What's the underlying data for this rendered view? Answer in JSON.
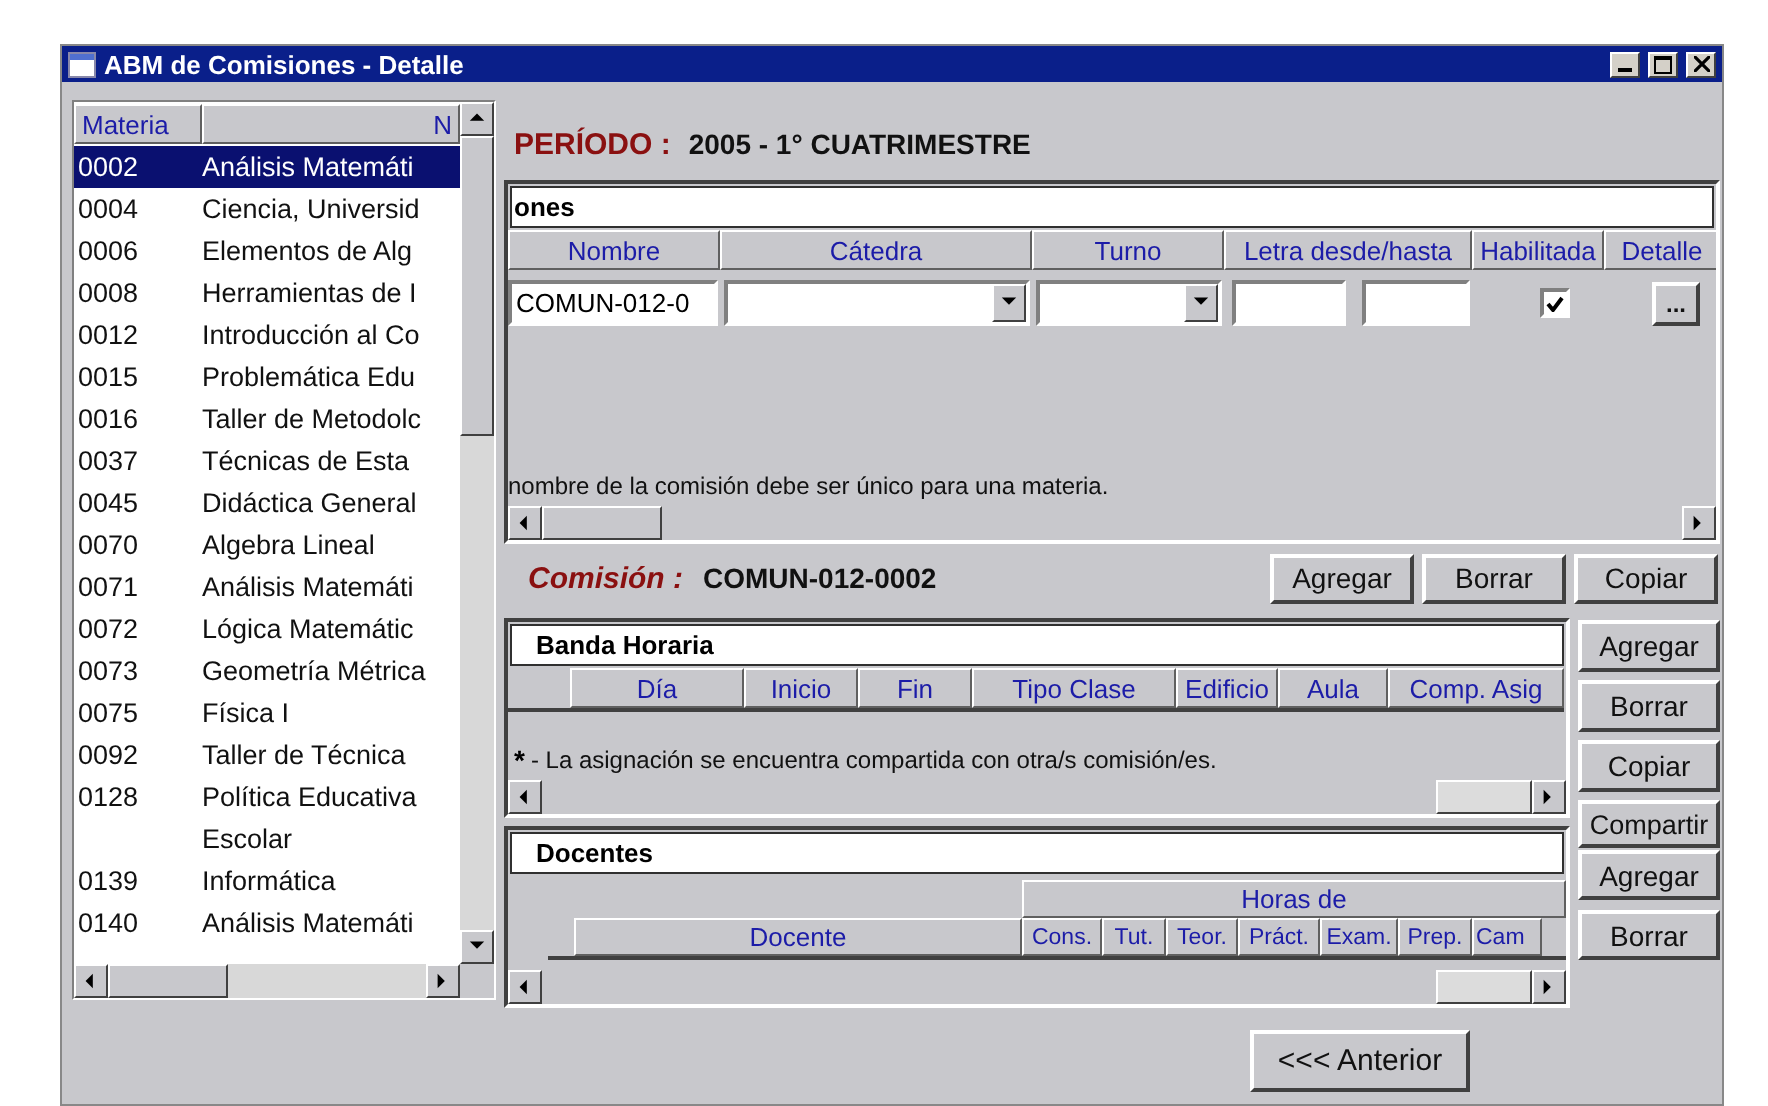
{
  "window": {
    "title": "ABM de Comisiones - Detalle"
  },
  "materias": {
    "columns": [
      "Materia",
      "N"
    ],
    "rows": [
      {
        "code": "0002",
        "name": "Análisis Matemáti",
        "selected": true
      },
      {
        "code": "0004",
        "name": "Ciencia, Universid",
        "selected": false
      },
      {
        "code": "0006",
        "name": "Elementos de Alg",
        "selected": false
      },
      {
        "code": "0008",
        "name": "Herramientas de I",
        "selected": false
      },
      {
        "code": "0012",
        "name": "Introducción al Co",
        "selected": false
      },
      {
        "code": "0015",
        "name": "Problemática Edu",
        "selected": false
      },
      {
        "code": "0016",
        "name": "Taller de Metodolc",
        "selected": false
      },
      {
        "code": "0037",
        "name": "Técnicas de Esta",
        "selected": false
      },
      {
        "code": "0045",
        "name": "Didáctica General",
        "selected": false
      },
      {
        "code": "0070",
        "name": "Algebra Lineal",
        "selected": false
      },
      {
        "code": "0071",
        "name": "Análisis Matemáti",
        "selected": false
      },
      {
        "code": "0072",
        "name": "Lógica Matemátic",
        "selected": false
      },
      {
        "code": "0073",
        "name": "Geometría Métrica",
        "selected": false
      },
      {
        "code": "0075",
        "name": "Física I",
        "selected": false
      },
      {
        "code": "0092",
        "name": "Taller de Técnica",
        "selected": false
      },
      {
        "code": "0128",
        "name": "Política Educativa Escolar",
        "selected": false
      },
      {
        "code": "0139",
        "name": "Informática",
        "selected": false
      },
      {
        "code": "0140",
        "name": "Análisis Matemáti",
        "selected": false
      }
    ]
  },
  "periodo": {
    "label": "PERÍODO :",
    "value": "2005 - 1° CUATRIMESTRE"
  },
  "comisiones": {
    "title": "ones",
    "columns": [
      "Nombre",
      "Cátedra",
      "Turno",
      "Letra desde/hasta",
      "Habilitada",
      "Detalle"
    ],
    "row": {
      "nombre": "COMUN-012-0",
      "habilitada": true,
      "detalle": "..."
    },
    "note": "nombre de la comisión debe ser único para una materia."
  },
  "comision": {
    "label": "Comisión :",
    "value": "COMUN-012-0002",
    "buttons": [
      "Agregar",
      "Borrar",
      "Copiar"
    ]
  },
  "banda_horaria": {
    "title": "Banda Horaria",
    "columns": [
      "Día",
      "Inicio",
      "Fin",
      "Tipo Clase",
      "Edificio",
      "Aula",
      "Comp. Asig"
    ],
    "note_mark": "*",
    "note": "- La asignación se encuentra compartida con otra/s comisión/es.",
    "buttons": [
      "Agregar",
      "Borrar",
      "Copiar",
      "Compartir"
    ]
  },
  "docentes": {
    "title": "Docentes",
    "group_header": "Horas de",
    "columns": [
      "Docente",
      "Cons.",
      "Tut.",
      "Teor.",
      "Práct.",
      "Exam.",
      "Prep.",
      "Cam"
    ],
    "buttons": [
      "Agregar",
      "Borrar"
    ]
  },
  "footer": {
    "button": "<<< Anterior"
  }
}
